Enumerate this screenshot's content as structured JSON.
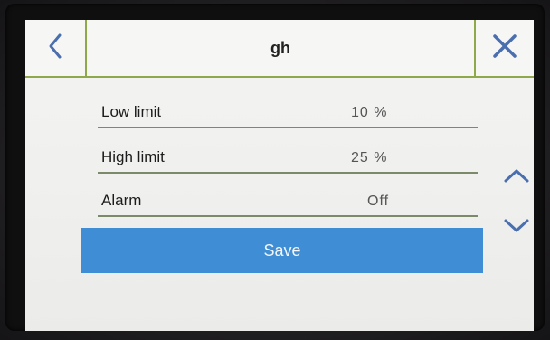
{
  "header": {
    "title": "gh"
  },
  "rows": [
    {
      "label": "Low limit",
      "value": "10 %"
    },
    {
      "label": "High limit",
      "value": "25 %"
    },
    {
      "label": "Alarm",
      "value": "Off"
    }
  ],
  "save_label": "Save",
  "icons": {
    "back": "chevron-left-icon",
    "close": "close-icon",
    "scroll_up": "chevron-up-icon",
    "scroll_down": "chevron-down-icon"
  },
  "colors": {
    "accent_line": "#8fa84a",
    "save_button": "#3f8dd4",
    "icon_blue": "#4a6fae"
  }
}
